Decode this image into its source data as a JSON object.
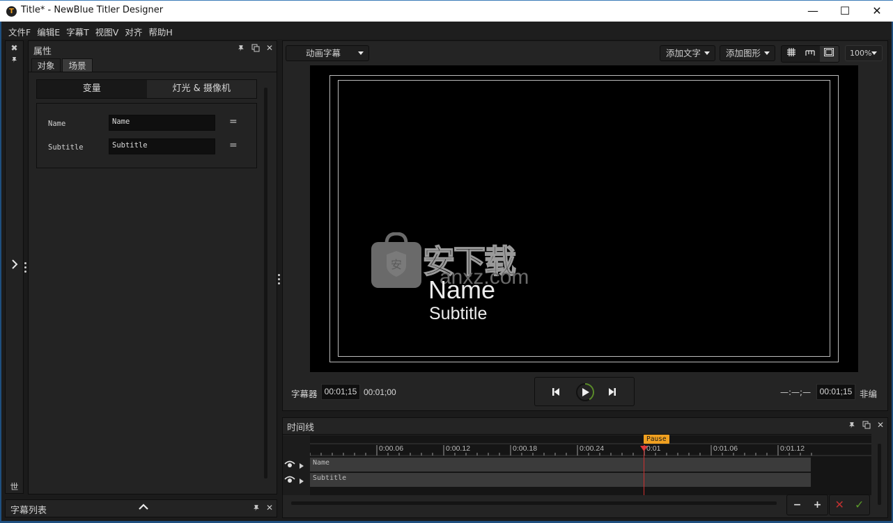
{
  "window": {
    "title": "Title* - NewBlue Titler Designer",
    "controls": {
      "minimize": "—",
      "maximize": "☐",
      "close": "✕"
    }
  },
  "menu": [
    "文件F",
    "编辑E",
    "字幕T",
    "视图V",
    "对齐",
    "帮助H"
  ],
  "left_strip": {
    "close_icon": "✖",
    "pin_icon": "📌",
    "expand_icon": "›",
    "bottom_label": "世"
  },
  "properties": {
    "title": "属性",
    "tabs": [
      {
        "label": "对象",
        "active": false
      },
      {
        "label": "场景",
        "active": true
      }
    ],
    "segments": [
      {
        "label": "变量",
        "active": true
      },
      {
        "label": "灯光 & 摄像机",
        "active": false
      }
    ],
    "variables": [
      {
        "label": "Name",
        "value": "Name"
      },
      {
        "label": "Subtitle",
        "value": "Subtitle"
      }
    ],
    "equals_icon": "="
  },
  "subtitle_list": {
    "title": "字幕列表"
  },
  "toolbar": {
    "mode_select": "动画字幕",
    "add_text": "添加文字",
    "add_shape": "添加图形",
    "zoom": "100%"
  },
  "preview": {
    "name_text": "Name",
    "subtitle_text": "Subtitle",
    "watermark_cn": "安下载",
    "watermark_url": "anxz.com"
  },
  "transport": {
    "label_left": "字幕器",
    "current_time": "00:01;15",
    "start_time": "00:01;00",
    "in_time": "—:—;—",
    "out_time": "00:01;15",
    "label_right": "非编"
  },
  "timeline": {
    "title": "时间线",
    "ticks": [
      "0:00.06",
      "0:00.12",
      "0:00.18",
      "0:00.24",
      "0:01",
      "0:01.06",
      "0:01.12"
    ],
    "playhead_label": "Pause",
    "tracks": [
      {
        "name": "Name"
      },
      {
        "name": "Subtitle"
      }
    ],
    "zoom_out": "−",
    "zoom_in": "+",
    "cancel": "✕",
    "confirm": "✓"
  },
  "colors": {
    "accent_orange": "#f0a020",
    "playhead_red": "#d03030",
    "cancel_red": "#c03030",
    "confirm_green": "#5a9a2a",
    "progress_green": "#5a8a2a"
  }
}
